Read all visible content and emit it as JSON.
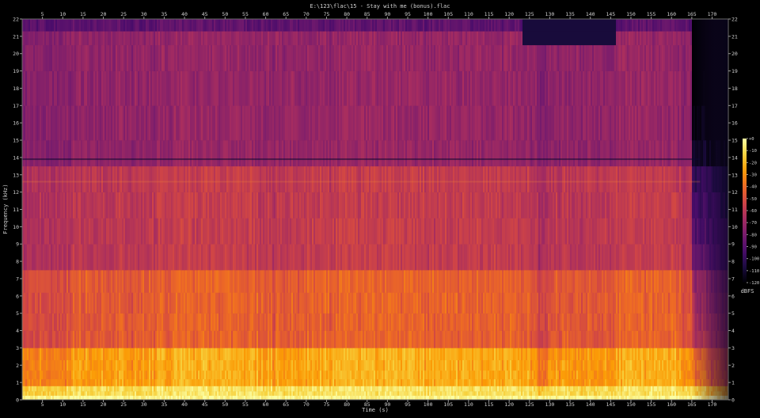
{
  "chart_data": {
    "type": "heatmap",
    "title": "E:\\123\\flac\\15 - Stay with me (bonus).flac",
    "xlabel": "Time (s)",
    "ylabel": "Frequency (kHz)",
    "xlim": [
      0,
      174
    ],
    "ylim": [
      0,
      22
    ],
    "x_ticks": [
      5,
      10,
      15,
      20,
      25,
      30,
      35,
      40,
      45,
      50,
      55,
      60,
      65,
      70,
      75,
      80,
      85,
      90,
      95,
      100,
      105,
      110,
      115,
      120,
      125,
      130,
      135,
      140,
      145,
      150,
      155,
      160,
      165,
      170
    ],
    "y_ticks": [
      1,
      2,
      3,
      4,
      5,
      6,
      7,
      8,
      9,
      10,
      11,
      12,
      13,
      14,
      15,
      16,
      17,
      18,
      19,
      20,
      21,
      22
    ],
    "y_zero_label": "0",
    "colorbar": {
      "label": "dBFS",
      "ticks": [
        0,
        -10,
        -20,
        -30,
        -40,
        -50,
        -60,
        -70,
        -80,
        -90,
        -100,
        -110,
        -120
      ],
      "tick_labels": [
        "+0",
        "-10",
        "-20",
        "-30",
        "-40",
        "-50",
        "-60",
        "-70",
        "-80",
        "-90",
        "-100",
        "-110",
        "-120"
      ],
      "range": [
        -120,
        0
      ]
    },
    "colormap": [
      "#000004",
      "#1b0c41",
      "#4a0c6b",
      "#781c6d",
      "#a52c60",
      "#cf4446",
      "#ed6925",
      "#fb9b06",
      "#f7d13d",
      "#fcffa4"
    ]
  }
}
